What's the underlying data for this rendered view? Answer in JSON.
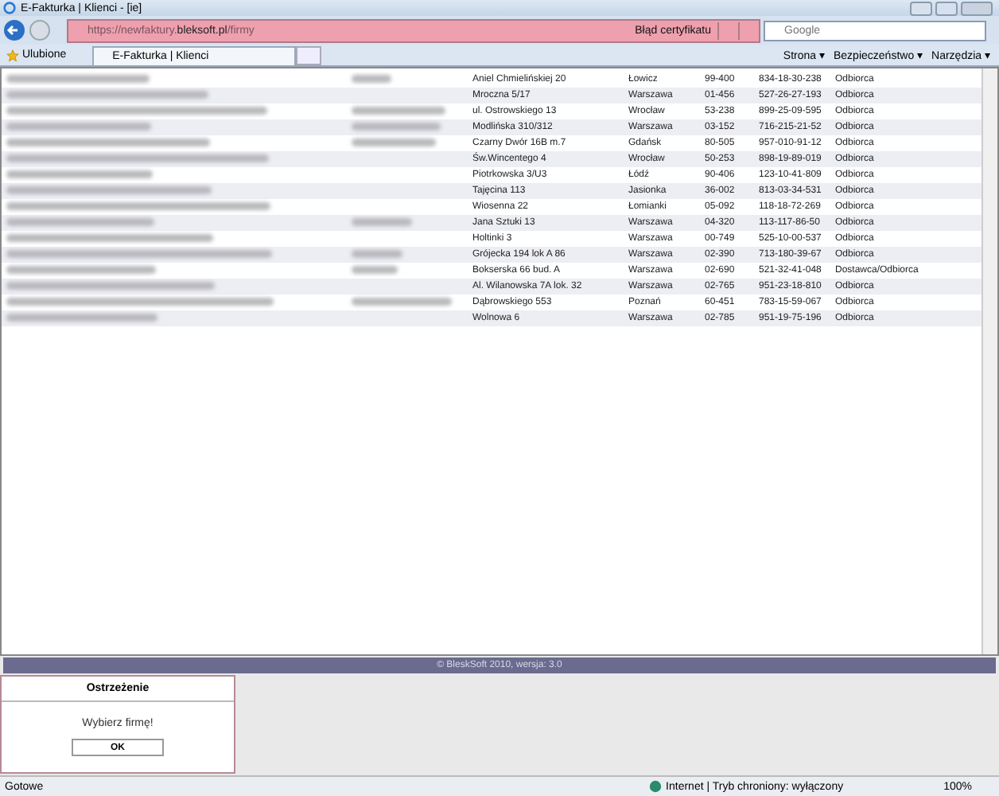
{
  "window": {
    "title": "E-Fakturka | Klienci - [ie]"
  },
  "address_bar": {
    "url_prefix": "https://newfaktury.",
    "url_domain": "bleksoft.pl",
    "url_path": "/firmy",
    "cert_error": "Błąd certyfikatu"
  },
  "search": {
    "placeholder": "Google"
  },
  "favorites": {
    "label": "Ulubione"
  },
  "tab": {
    "label": "E-Fakturka | Klienci"
  },
  "toolbar": {
    "items": [
      "Strona ▾",
      "Bezpieczeństwo ▾",
      "Narzędzia ▾"
    ]
  },
  "table": {
    "rows": [
      {
        "name_redacted": true,
        "col2_redacted": true,
        "street": "Aniel Chmielińskiej 20",
        "city": "Łowicz",
        "zip": "99-400",
        "nip": "834-18-30-238",
        "type": "Odbiorca"
      },
      {
        "name_redacted": true,
        "col2_redacted": false,
        "street": "Mroczna 5/17",
        "city": "Warszawa",
        "zip": "01-456",
        "nip": "527-26-27-193",
        "type": "Odbiorca"
      },
      {
        "name_redacted": true,
        "col2_redacted": true,
        "street": "ul. Ostrowskiego 13",
        "city": "Wrocław",
        "zip": "53-238",
        "nip": "899-25-09-595",
        "type": "Odbiorca"
      },
      {
        "name_redacted": true,
        "col2_redacted": true,
        "street": "Modlińska 310/312",
        "city": "Warszawa",
        "zip": "03-152",
        "nip": "716-215-21-52",
        "type": "Odbiorca"
      },
      {
        "name_redacted": true,
        "col2_redacted": true,
        "street": "Czarny Dwór 16B m.7",
        "city": "Gdańsk",
        "zip": "80-505",
        "nip": "957-010-91-12",
        "type": "Odbiorca"
      },
      {
        "name_redacted": true,
        "col2_redacted": false,
        "street": "Św.Wincentego 4",
        "city": "Wrocław",
        "zip": "50-253",
        "nip": "898-19-89-019",
        "type": "Odbiorca"
      },
      {
        "name_redacted": true,
        "col2_redacted": false,
        "street": "Piotrkowska 3/U3",
        "city": "Łódź",
        "zip": "90-406",
        "nip": "123-10-41-809",
        "type": "Odbiorca"
      },
      {
        "name_redacted": true,
        "col2_redacted": false,
        "street": "Tajęcina 113",
        "city": "Jasionka",
        "zip": "36-002",
        "nip": "813-03-34-531",
        "type": "Odbiorca"
      },
      {
        "name_redacted": true,
        "col2_redacted": false,
        "street": "Wiosenna 22",
        "city": "Łomianki",
        "zip": "05-092",
        "nip": "118-18-72-269",
        "type": "Odbiorca"
      },
      {
        "name_redacted": true,
        "col2_redacted": true,
        "street": "Jana Sztuki 13",
        "city": "Warszawa",
        "zip": "04-320",
        "nip": "113-117-86-50",
        "type": "Odbiorca"
      },
      {
        "name_redacted": true,
        "col2_redacted": false,
        "street": "Holtinki 3",
        "city": "Warszawa",
        "zip": "00-749",
        "nip": "525-10-00-537",
        "type": "Odbiorca"
      },
      {
        "name_redacted": true,
        "col2_redacted": true,
        "street": "Grójecka 194 lok A 86",
        "city": "Warszawa",
        "zip": "02-390",
        "nip": "713-180-39-67",
        "type": "Odbiorca"
      },
      {
        "name_redacted": true,
        "col2_redacted": true,
        "street": "Bokserska 66 bud. A",
        "city": "Warszawa",
        "zip": "02-690",
        "nip": "521-32-41-048",
        "type": "Dostawca/Odbiorca"
      },
      {
        "name_redacted": true,
        "col2_redacted": false,
        "street": "Al. Wilanowska 7A lok. 32",
        "city": "Warszawa",
        "zip": "02-765",
        "nip": "951-23-18-810",
        "type": "Odbiorca"
      },
      {
        "name_redacted": true,
        "col2_redacted": true,
        "street": "Dąbrowskiego 553",
        "city": "Poznań",
        "zip": "60-451",
        "nip": "783-15-59-067",
        "type": "Odbiorca"
      },
      {
        "name_redacted": true,
        "col2_redacted": false,
        "street": "Wolnowa 6",
        "city": "Warszawa",
        "zip": "02-785",
        "nip": "951-19-75-196",
        "type": "Odbiorca"
      }
    ]
  },
  "footer": {
    "text": "© BleskSoft 2010, wersja: 3.0"
  },
  "dialog": {
    "title": "Ostrzeżenie",
    "message": "Wybierz firmę!",
    "button": "OK"
  },
  "status_bar": {
    "left": "Gotowe",
    "zone": "Internet | Tryb chroniony: wyłączony",
    "zoom": "100%"
  }
}
